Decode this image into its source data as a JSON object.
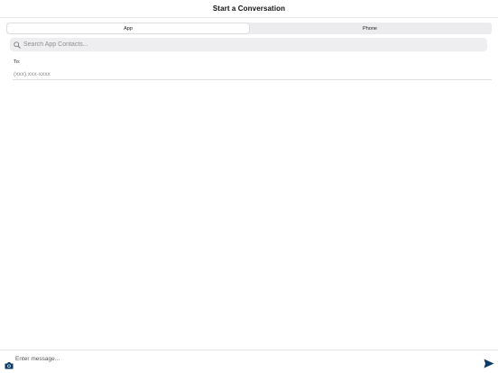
{
  "header": {
    "title": "Start a Conversation"
  },
  "segmented": {
    "tabs": [
      {
        "label": "App",
        "active": true
      },
      {
        "label": "Phone",
        "active": false
      }
    ]
  },
  "search": {
    "placeholder": "Search App Contacts...",
    "icon": "search-icon"
  },
  "recipient": {
    "label": "To:",
    "placeholder": "(xxx) xxx-xxxx"
  },
  "composer": {
    "placeholder": "Enter message...",
    "camera_icon": "camera-icon",
    "send_icon": "send-icon"
  },
  "colors": {
    "accent": "#0b3a66",
    "segment_bg": "#ececee",
    "search_bg": "#eeeef0",
    "placeholder": "#8e8e93"
  }
}
